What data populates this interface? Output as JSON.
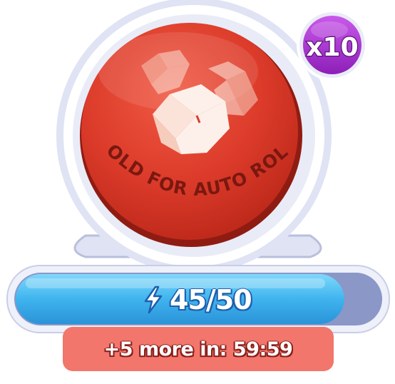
{
  "roll_button": {
    "label": "HOLD FOR AUTO ROLL",
    "icon": "dice-icon"
  },
  "multiplier": {
    "label": "x10",
    "color": "#a82ed0"
  },
  "energy": {
    "text": "45/50",
    "fraction": 0.9,
    "icon": "lightning-bolt-icon",
    "fill_color": "#3fb4ee"
  },
  "refill_timer": {
    "text": "+5 more in: 59:59"
  },
  "colors": {
    "button_red": "#d93a2b",
    "pill_red": "#f2766b",
    "frame": "#dfe3f4"
  }
}
